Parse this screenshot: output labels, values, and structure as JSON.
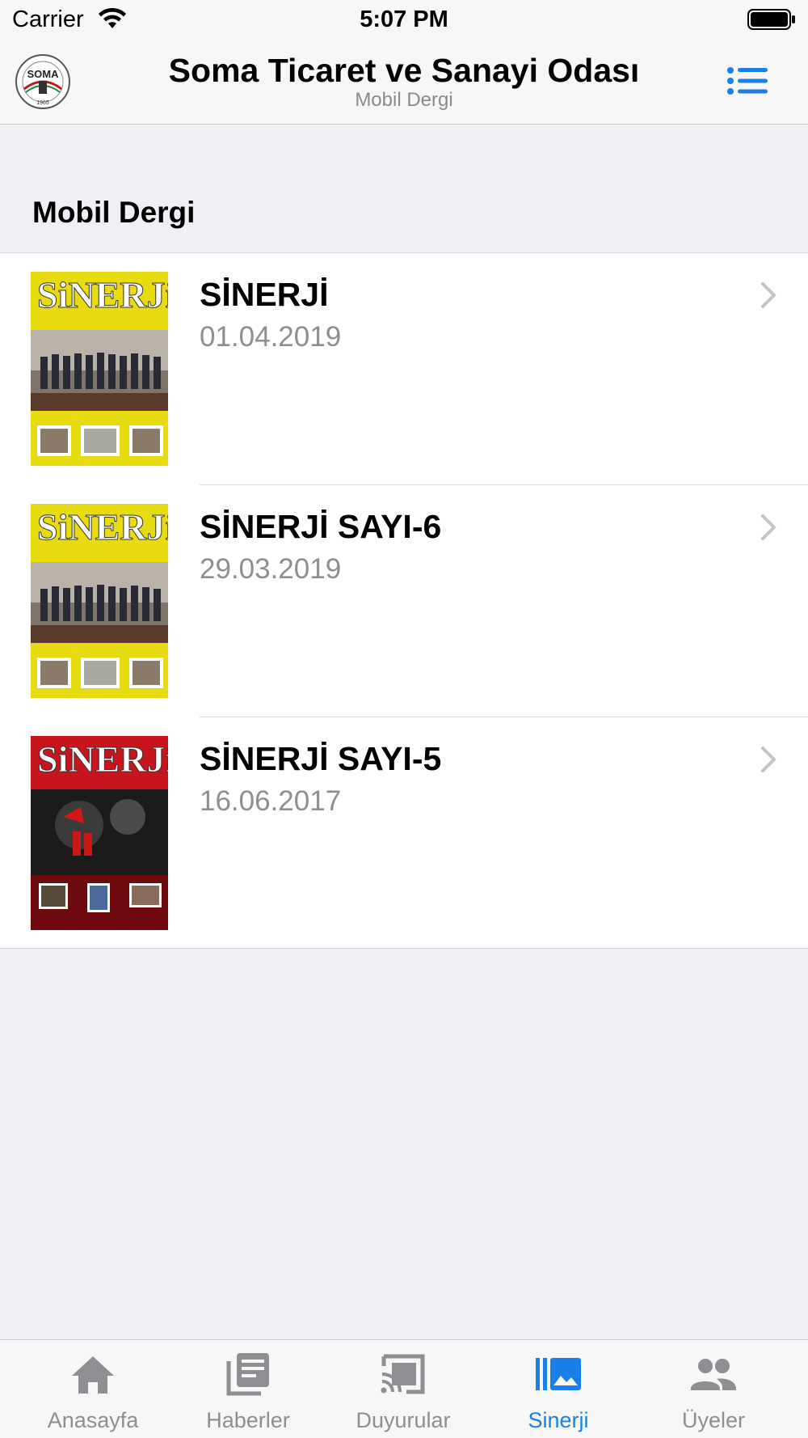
{
  "status_bar": {
    "carrier": "Carrier",
    "time": "5:07 PM"
  },
  "nav": {
    "title": "Soma Ticaret ve Sanayi Odası",
    "subtitle": "Mobil Dergi",
    "logo_text": "SOMA",
    "menu_icon": "list-icon"
  },
  "section": {
    "title": "Mobil Dergi"
  },
  "magazines": [
    {
      "title": "SİNERJİ",
      "date": "01.04.2019",
      "cover_title": "SiNERJi",
      "cover_color": "#e8dc10"
    },
    {
      "title": "SİNERJİ SAYI-6",
      "date": "29.03.2019",
      "cover_title": "SiNERJi",
      "cover_color": "#e8dc10"
    },
    {
      "title": "SİNERJİ SAYI-5",
      "date": "16.06.2017",
      "cover_title": "SiNERJi",
      "cover_color": "#c8141c"
    }
  ],
  "tabs": [
    {
      "label": "Anasayfa",
      "icon": "home-icon"
    },
    {
      "label": "Haberler",
      "icon": "news-icon"
    },
    {
      "label": "Duyurular",
      "icon": "cast-icon"
    },
    {
      "label": "Sinerji",
      "icon": "gallery-icon"
    },
    {
      "label": "Üyeler",
      "icon": "people-icon"
    }
  ],
  "colors": {
    "accent": "#1a7fe8",
    "inactive": "#8e8e93",
    "background": "#efeff4"
  }
}
